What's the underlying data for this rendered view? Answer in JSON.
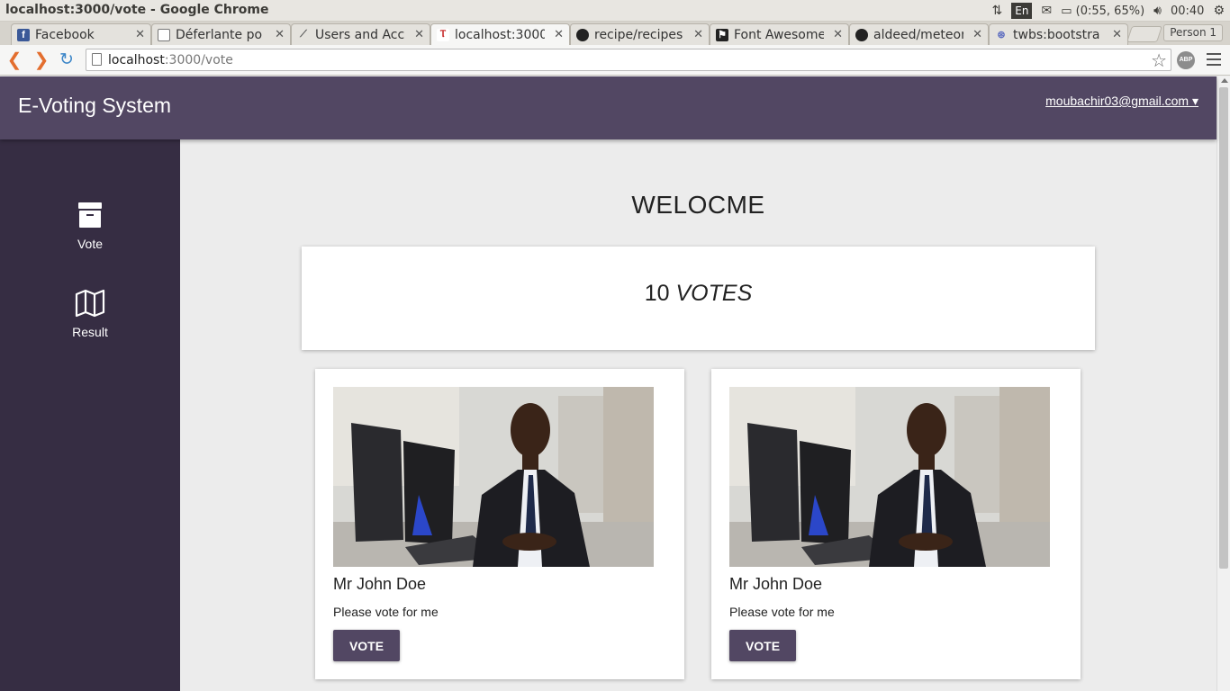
{
  "window": {
    "title": "localhost:3000/vote - Google Chrome"
  },
  "tray": {
    "lang": "En",
    "battery": "(0:55, 65%)",
    "clock": "00:40"
  },
  "tabs": [
    {
      "title": "Facebook",
      "icon": "facebook-icon"
    },
    {
      "title": "Déferlante po",
      "icon": "page-icon"
    },
    {
      "title": "Users and Acc",
      "icon": "feather-icon"
    },
    {
      "title": "localhost:3000",
      "icon": "meteor-icon"
    },
    {
      "title": "recipe/recipes",
      "icon": "github-icon"
    },
    {
      "title": "Font Awesome",
      "icon": "flag-icon"
    },
    {
      "title": "aldeed/meteor",
      "icon": "github-icon"
    },
    {
      "title": "twbs:bootstra",
      "icon": "atmosphere-icon"
    }
  ],
  "profile": "Person 1",
  "address": {
    "host": "localhost",
    "path": ":3000/vote"
  },
  "extension": "ABP",
  "app": {
    "brand": "E-Voting System",
    "user_email": "moubachir03@gmail.com ▾"
  },
  "sidebar": {
    "items": [
      {
        "label": "Vote",
        "icon": "archive-box-icon"
      },
      {
        "label": "Result",
        "icon": "map-icon"
      }
    ]
  },
  "main": {
    "welcome": "WELOCME",
    "votes_count": "10",
    "votes_unit": "VOTES"
  },
  "candidates": [
    {
      "name": "Mr John Doe",
      "message": "Please vote for me",
      "button": "VOTE"
    },
    {
      "name": "Mr John Doe",
      "message": "Please vote for me",
      "button": "VOTE"
    }
  ],
  "colors": {
    "header": "#524763",
    "sidebar": "#362d43",
    "content_bg": "#ececec"
  }
}
